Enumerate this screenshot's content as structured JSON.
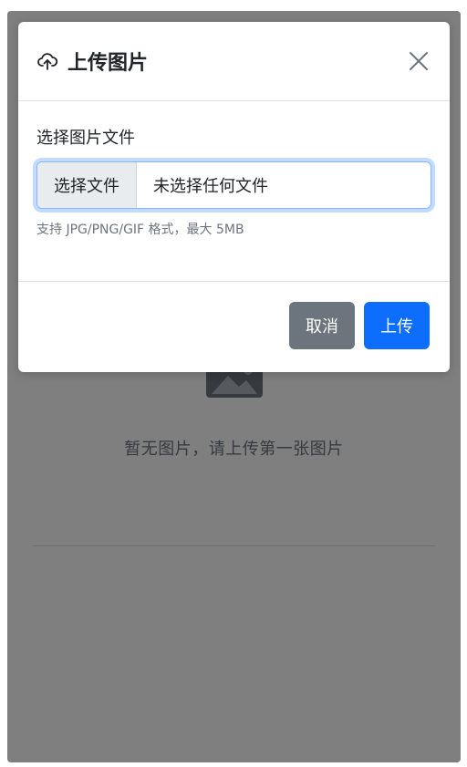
{
  "modal": {
    "title": "上传图片",
    "title_icon": "cloud-upload-icon",
    "close_icon": "close-icon",
    "field_label": "选择图片文件",
    "file_button_label": "选择文件",
    "file_name": "未选择任何文件",
    "help_text": "支持 JPG/PNG/GIF 格式，最大 5MB",
    "cancel_label": "取消",
    "upload_label": "上传"
  },
  "background": {
    "empty_icon": "image-icon",
    "empty_text": "暂无图片，请上传第一张图片"
  },
  "colors": {
    "primary": "#0d6efd",
    "secondary": "#6c757d",
    "backdrop": "rgba(0,0,0,0.5)"
  }
}
